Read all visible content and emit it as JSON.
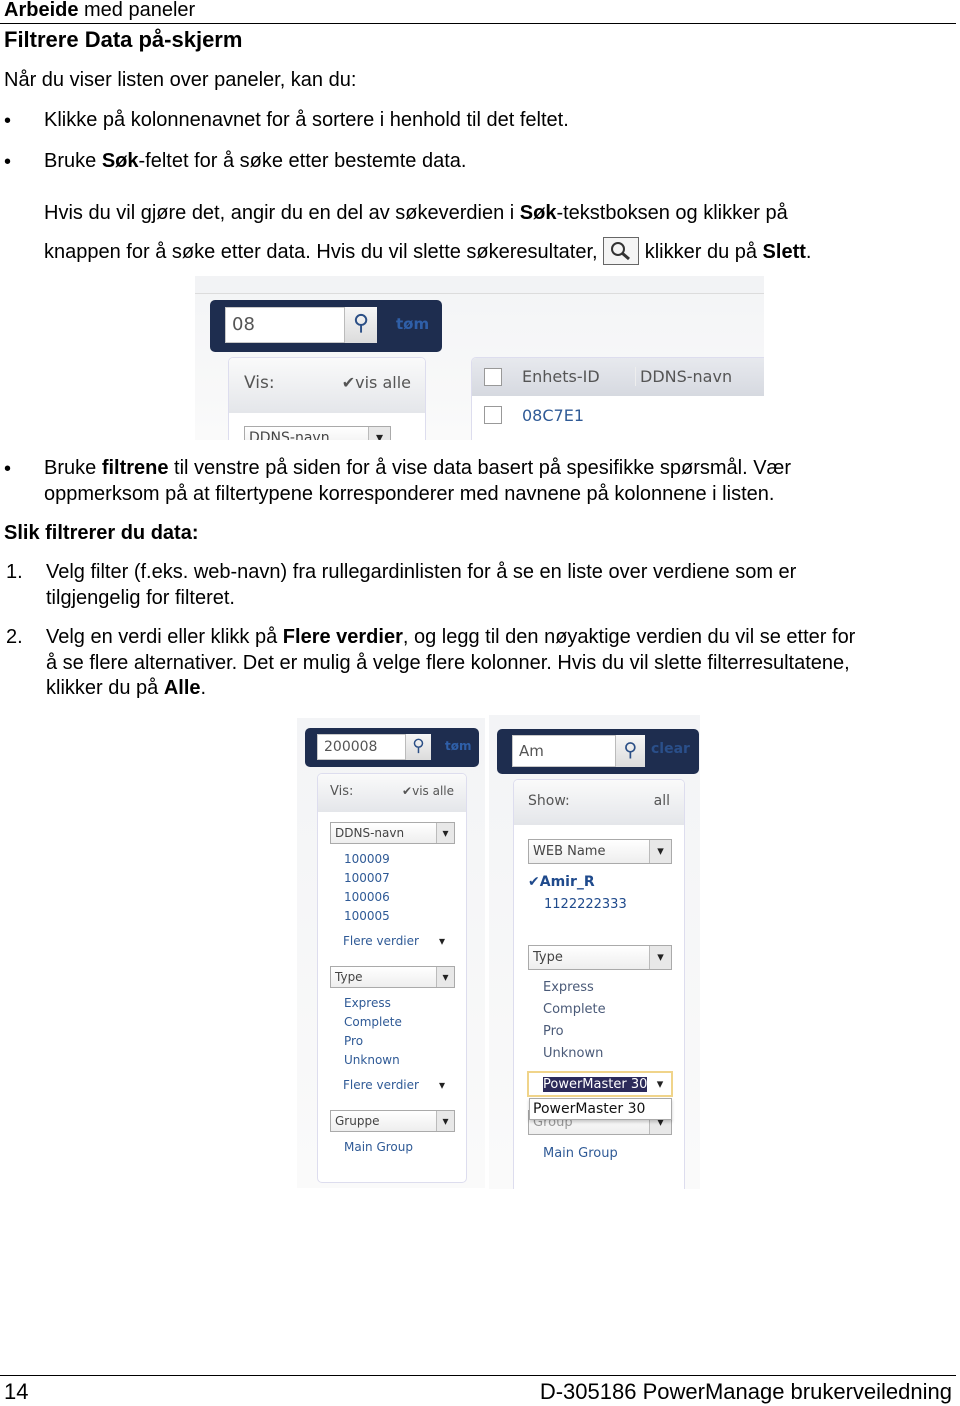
{
  "header": {
    "chapter_bold": "Arbeide",
    "chapter_rest": " med paneler"
  },
  "section_title": "Filtrere Data på-skjerm",
  "intro": "Når du viser listen over paneler, kan du:",
  "bullets": [
    {
      "text": "Klikke på kolonnenavnet for å sortere i henhold til det feltet."
    },
    {
      "pre": "Bruke ",
      "bold": "Søk",
      "post": "-feltet for å søke etter bestemte data."
    }
  ],
  "search_para": {
    "l1_pre": "Hvis du vil gjøre det, angir du en del av søkeverdien i ",
    "l1_bold": "Søk",
    "l1_post": "-tekstboksen og klikker på",
    "l2_pre": "knappen for å søke etter data. Hvis du vil slette søkeresultater, ",
    "l2_post": " klikker du på ",
    "l2_bold": "Slett",
    "l2_end": "."
  },
  "shot1": {
    "search_value": "08",
    "clear_label": "tøm",
    "show_label": "Vis:",
    "show_all": "vis alle",
    "filter_select": "DDNS-navn",
    "columns": [
      "Enhets-ID",
      "DDNS-navn"
    ],
    "rows": [
      {
        "id": "08C7E1"
      }
    ]
  },
  "bullet3": {
    "pre": "Bruke ",
    "bold": "filtrene",
    "post": " til venstre på siden for å vise data basert på spesifikke spørsmål. Vær",
    "l2": "oppmerksom på at filtertypene korresponderer med navnene på kolonnene i listen."
  },
  "howto_title": "Slik filtrerer du data:",
  "steps": [
    {
      "num": "1.",
      "l1": "Velg filter (f.eks. web-navn) fra rullegardinlisten for å se en liste over verdiene som er",
      "l2": "tilgjengelig for filteret."
    },
    {
      "num": "2.",
      "l1_pre": "Velg en verdi eller klikk på ",
      "l1_bold": "Flere verdier",
      "l1_post": ", og legg til den nøyaktige verdien du vil se etter for",
      "l2": "å se flere alternativer. Det er mulig å velge flere kolonner. Hvis du vil slette filterresultatene,",
      "l3_pre": "klikker du på ",
      "l3_bold": "Alle",
      "l3_end": "."
    }
  ],
  "shot2_left": {
    "search_value": "200008",
    "clear_label": "tøm",
    "show_label": "Vis:",
    "show_all": "vis alle",
    "groups": [
      {
        "select": "DDNS-navn",
        "values": [
          "100009",
          "100007",
          "100006",
          "100005"
        ],
        "more": "Flere verdier"
      },
      {
        "select": "Type",
        "values": [
          "Express",
          "Complete",
          "Pro",
          "Unknown"
        ],
        "more": "Flere verdier"
      },
      {
        "select": "Gruppe",
        "values": [
          "Main Group"
        ]
      }
    ]
  },
  "shot2_right": {
    "search_value": "Am",
    "clear_label": "clear",
    "show_label": "Show:",
    "show_all": "all",
    "web_select": "WEB Name",
    "web_values": [
      "Amir_R",
      "1122222333"
    ],
    "type_select": "Type",
    "type_values": [
      "Express",
      "Complete",
      "Pro",
      "Unknown"
    ],
    "model_select": "PowerMaster 30",
    "dropdown_option": "PowerMaster 30",
    "group_select": "Group",
    "group_values": [
      "Main Group"
    ]
  },
  "footer": {
    "page": "14",
    "doc": "D-305186 PowerManage brukerveiledning"
  }
}
